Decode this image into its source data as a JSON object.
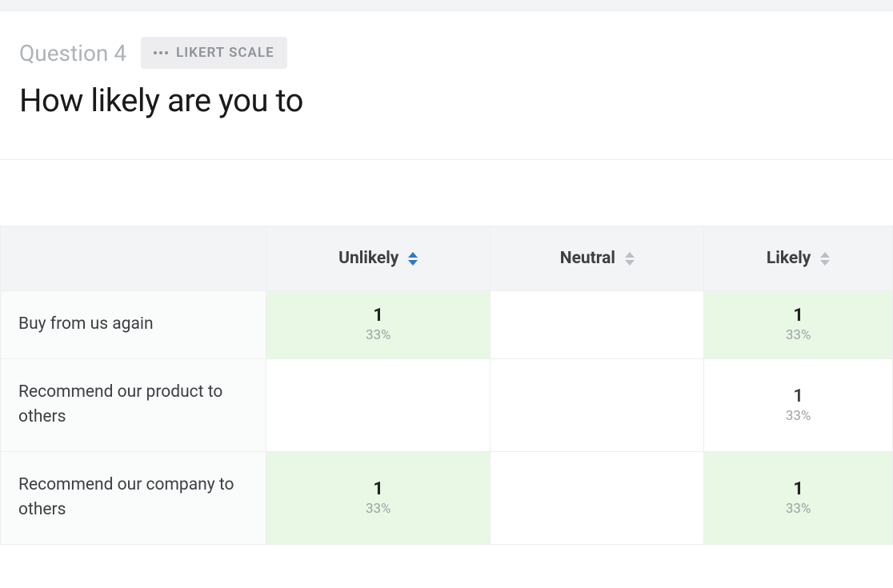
{
  "question": {
    "label": "Question 4",
    "type_badge": "LIKERT SCALE",
    "title": "How likely are you to"
  },
  "table": {
    "columns": [
      {
        "label": "Unlikely",
        "sort_active": true
      },
      {
        "label": "Neutral",
        "sort_active": false
      },
      {
        "label": "Likely",
        "sort_active": false
      }
    ],
    "rows": [
      {
        "label": "Buy from us again",
        "cells": [
          {
            "count": "1",
            "pct": "33%",
            "highlight": true
          },
          {
            "count": "",
            "pct": "",
            "highlight": false
          },
          {
            "count": "1",
            "pct": "33%",
            "highlight": true
          }
        ]
      },
      {
        "label": "Recommend our product to others",
        "cells": [
          {
            "count": "",
            "pct": "",
            "highlight": false
          },
          {
            "count": "",
            "pct": "",
            "highlight": false
          },
          {
            "count": "1",
            "pct": "33%",
            "highlight": false
          }
        ]
      },
      {
        "label": "Recommend our company to others",
        "cells": [
          {
            "count": "1",
            "pct": "33%",
            "highlight": true
          },
          {
            "count": "",
            "pct": "",
            "highlight": false
          },
          {
            "count": "1",
            "pct": "33%",
            "highlight": true
          }
        ]
      }
    ]
  }
}
